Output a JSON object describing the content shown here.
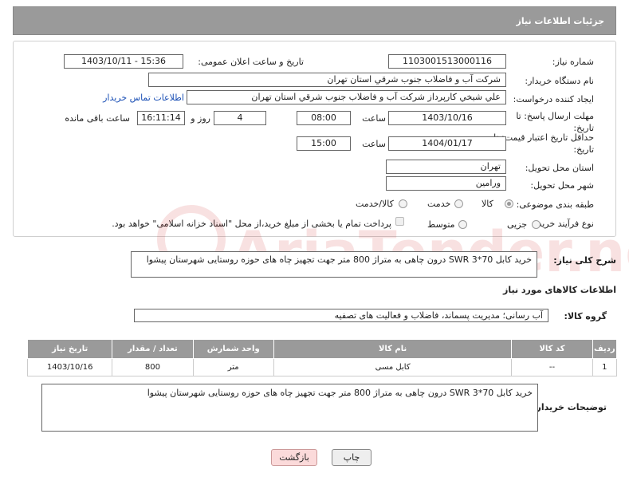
{
  "header": {
    "title": "جزئیات اطلاعات نیاز"
  },
  "form": {
    "need_number_label": "شماره نیاز:",
    "need_number": "1103001513000116",
    "announce_label": "تاریخ و ساعت اعلان عمومی:",
    "announce_value": "1403/10/11 - 15:36",
    "buyer_org_label": "نام دستگاه خریدار:",
    "buyer_org": "شرکت آب و فاضلاب جنوب شرقي استان تهران",
    "requester_label": "ایجاد کننده درخواست:",
    "requester": "علي شيخي کارپرداز شرکت آب و فاضلاب جنوب شرقي استان تهران",
    "contact_link": "اطلاعات تماس خریدار",
    "reply_deadline_label": "مهلت ارسال پاسخ: تا تاریخ:",
    "reply_date": "1403/10/16",
    "time_label": "ساعت",
    "reply_time": "08:00",
    "days_value": "4",
    "days_label": "روز و",
    "remaining_time": "16:11:14",
    "remaining_label": "ساعت باقی مانده",
    "price_validity_label": "حداقل تاریخ اعتبار قیمت: تا تاریخ:",
    "validity_date": "1404/01/17",
    "validity_time": "15:00",
    "province_label": "استان محل تحویل:",
    "province": "تهران",
    "city_label": "شهر محل تحویل:",
    "city": "ورامین",
    "category_label": "طبقه بندی موضوعی:",
    "category_options": [
      "کالا",
      "خدمت",
      "کالا/خدمت"
    ],
    "purchase_type_label": "نوع فرآیند خرید :",
    "purchase_type_options": [
      "جزیی",
      "متوسط"
    ],
    "payment_note": "پرداخت تمام یا بخشی از مبلغ خرید،از محل \"اسناد خزانه اسلامی\" خواهد بود."
  },
  "summary": {
    "label": "شرح کلی نیاز:",
    "text": "خرید کابل 70*SWR 3 درون چاهی به متراژ 800 متر جهت تجهیز چاه های حوزه روستایی شهرستان پیشوا"
  },
  "goods": {
    "section_title": "اطلاعات کالاهای مورد نیاز",
    "group_label": "گروه کالا:",
    "group_value": "آب رسانی؛ مدیریت پسماند، فاضلاب و فعالیت های تصفیه",
    "columns": [
      "ردیف",
      "کد کالا",
      "نام کالا",
      "واحد شمارش",
      "تعداد / مقدار",
      "تاریخ نیاز"
    ],
    "rows": [
      [
        "1",
        "--",
        "کابل مسی",
        "متر",
        "800",
        "1403/10/16"
      ]
    ]
  },
  "buyer_notes": {
    "label": "توضیحات خریدار:",
    "text": "خرید کابل 70*SWR 3 درون چاهی به متراژ 800 متر جهت تجهیز چاه های حوزه روستایی شهرستان پیشوا"
  },
  "buttons": {
    "print": "چاپ",
    "back": "بازگشت"
  },
  "watermark_text": "AriaTender.neT",
  "colors": {
    "header_bg": "#9a9a9a",
    "link": "#1a4fb5",
    "back_button": "#fbdada",
    "watermark": "#cc2222"
  }
}
